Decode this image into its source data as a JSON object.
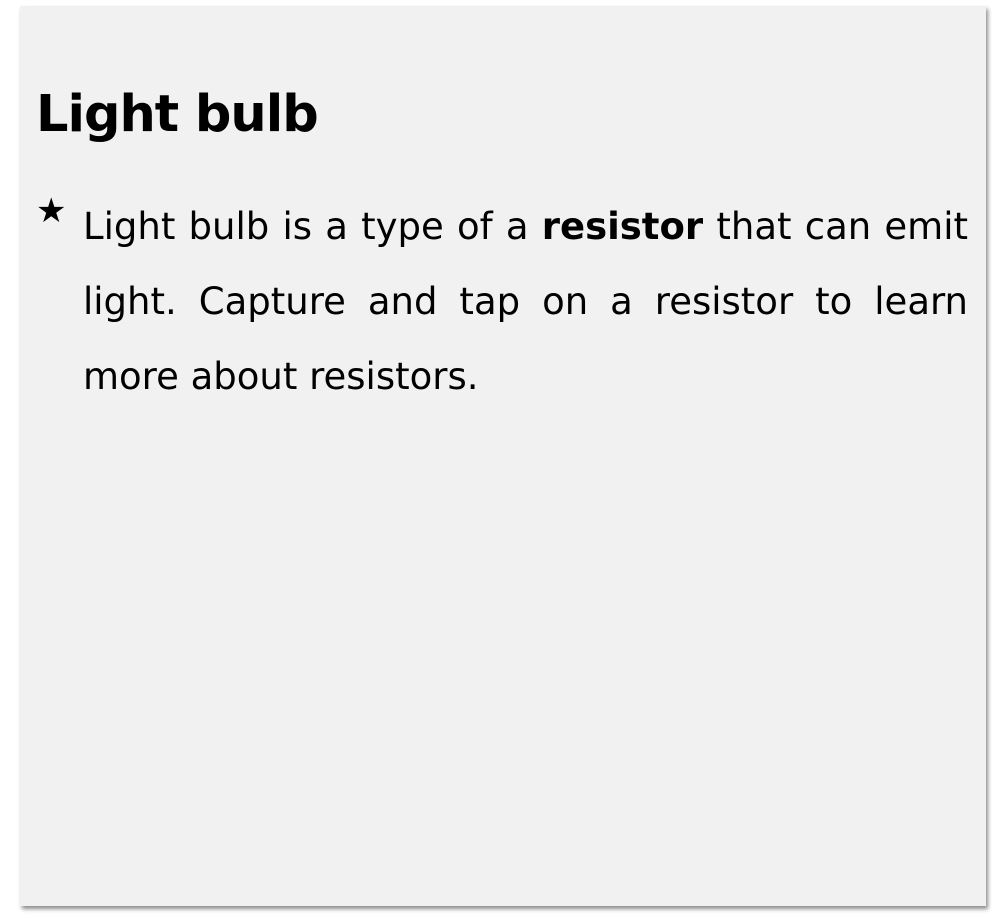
{
  "card": {
    "title": "Light bulb",
    "bullet_icon": "star-icon",
    "bullet_glyph": "★",
    "text_before": "Light bulb is a type of a ",
    "text_bold": "resistor",
    "text_after": " that can emit light. Capture and tap on a resistor to learn more about resistors."
  }
}
